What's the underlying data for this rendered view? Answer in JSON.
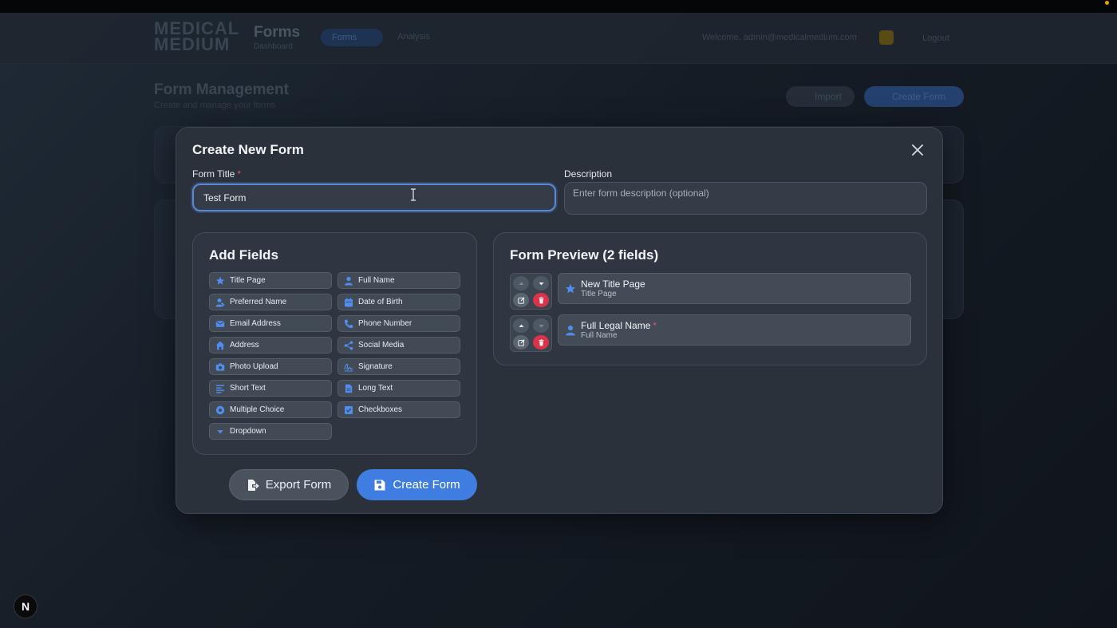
{
  "background": {
    "logo": "MEDICAL MEDIUM",
    "app_title": "Forms",
    "app_subtitle": "Dashboard",
    "nav_forms": "Forms",
    "nav_analysis": "Analysis",
    "welcome": "Welcome, admin@medicalmedium.com",
    "logout": "Logout",
    "page_title": "Form Management",
    "page_subtitle": "Create and manage your forms",
    "import_label": "Import",
    "create_label": "Create Form"
  },
  "modal": {
    "title": "Create New Form",
    "form_title_label": "Form Title",
    "required_mark": "*",
    "form_title_value": "Test Form",
    "description_label": "Description",
    "description_placeholder": "Enter form description (optional)"
  },
  "add_fields": {
    "title": "Add Fields",
    "items": [
      {
        "label": "Title Page",
        "icon": "star-icon"
      },
      {
        "label": "Full Name",
        "icon": "person-icon"
      },
      {
        "label": "Preferred Name",
        "icon": "person-tag-icon"
      },
      {
        "label": "Date of Birth",
        "icon": "calendar-icon"
      },
      {
        "label": "Email Address",
        "icon": "envelope-icon"
      },
      {
        "label": "Phone Number",
        "icon": "phone-icon"
      },
      {
        "label": "Address",
        "icon": "home-icon"
      },
      {
        "label": "Social Media",
        "icon": "share-icon"
      },
      {
        "label": "Photo Upload",
        "icon": "camera-icon"
      },
      {
        "label": "Signature",
        "icon": "signature-icon"
      },
      {
        "label": "Short Text",
        "icon": "lines-icon"
      },
      {
        "label": "Long Text",
        "icon": "document-icon"
      },
      {
        "label": "Multiple Choice",
        "icon": "radio-icon"
      },
      {
        "label": "Checkboxes",
        "icon": "checkbox-icon"
      },
      {
        "label": "Dropdown",
        "icon": "caret-down-icon"
      }
    ]
  },
  "preview": {
    "title": "Form Preview (2 fields)",
    "items": [
      {
        "name": "New Title Page",
        "type": "Title Page",
        "required": false,
        "icon": "star-icon"
      },
      {
        "name": "Full Legal Name",
        "type": "Full Name",
        "required": true,
        "icon": "person-icon"
      }
    ]
  },
  "actions": {
    "export_label": "Export Form",
    "create_label": "Create Form"
  },
  "badge": "N",
  "colors": {
    "accent": "#3f7ee0",
    "icon_blue": "#4f8ef0",
    "danger": "#d9344a",
    "required": "#e05260"
  }
}
